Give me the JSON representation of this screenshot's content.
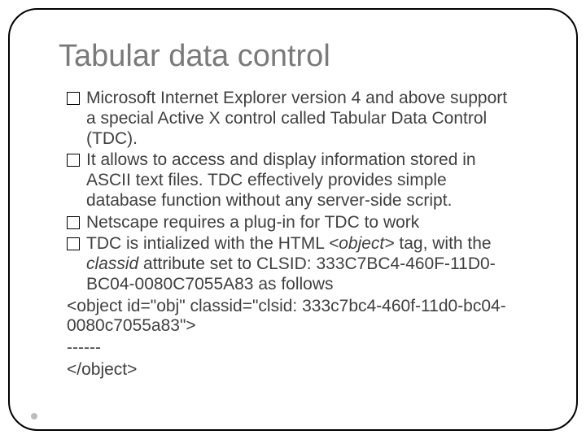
{
  "title": "Tabular data control",
  "bullets": {
    "b1": "Microsoft Internet Explorer version 4 and above support a special Active X control called Tabular Data Control (TDC).",
    "b2": "It allows to access and display information stored in ASCII text files. TDC effectively provides simple database function without any server-side script.",
    "b3": "Netscape requires a plug-in for TDC to work",
    "b4_pre": "TDC is intialized with the HTML ",
    "b4_obj": "<object>",
    "b4_mid": " tag, with the ",
    "b4_classid": "classid",
    "b4_post": " attribute set to CLSID: 333C7BC4-460F-11D0-BC04-0080C7055A83 as follows"
  },
  "code": {
    "line1": "<object id=\"obj\" classid=\"clsid: 333c7bc4-460f-11d0-bc04-0080c7055a83\">",
    "dashes": "------",
    "line2": "</object>"
  }
}
